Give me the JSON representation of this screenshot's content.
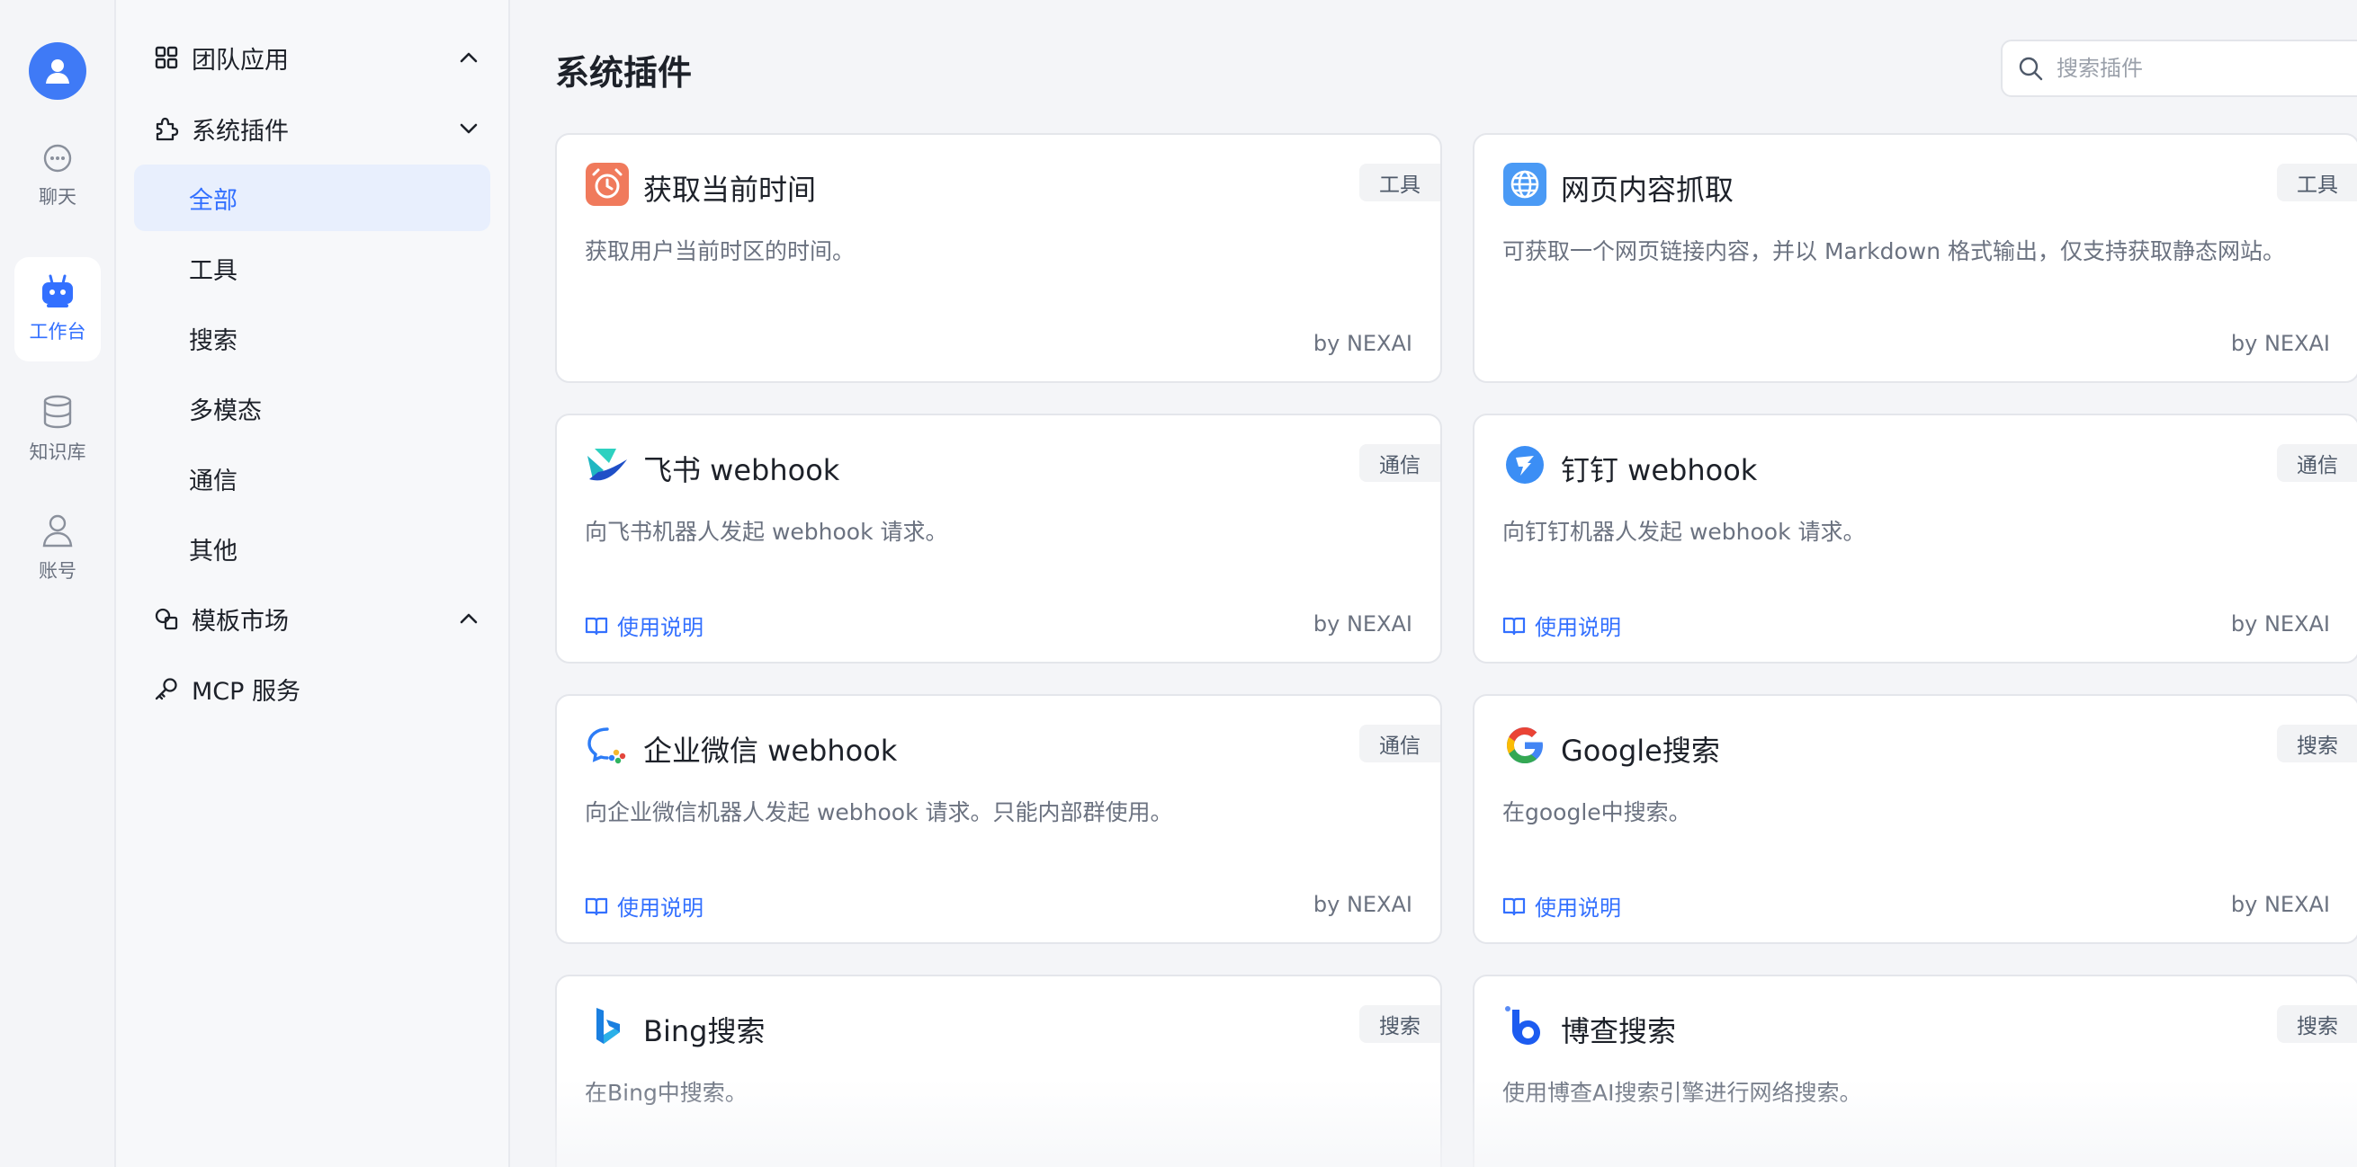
{
  "rail": {
    "items": [
      {
        "label": "聊天",
        "icon": "chat-icon"
      },
      {
        "label": "工作台",
        "icon": "bot-icon",
        "active": true
      },
      {
        "label": "知识库",
        "icon": "database-icon"
      },
      {
        "label": "账号",
        "icon": "user-icon"
      }
    ]
  },
  "menu": {
    "team_apps": "团队应用",
    "system_plugins": "系统插件",
    "subitems": [
      "全部",
      "工具",
      "搜索",
      "多模态",
      "通信",
      "其他"
    ],
    "template_market": "模板市场",
    "mcp": "MCP 服务"
  },
  "main": {
    "title": "系统插件",
    "search_placeholder": "搜索插件"
  },
  "cards": [
    {
      "title": "获取当前时间",
      "tag": "工具",
      "desc": "获取用户当前时区的时间。",
      "by": "by NEXAI",
      "icon": "alarm-clock-icon"
    },
    {
      "title": "网页内容抓取",
      "tag": "工具",
      "desc": "可获取一个网页链接内容，并以 Markdown 格式输出，仅支持获取静态网站。",
      "by": "by NEXAI",
      "icon": "globe-icon"
    },
    {
      "title": "飞书 webhook",
      "tag": "通信",
      "desc": "向飞书机器人发起 webhook 请求。",
      "doc": "使用说明",
      "by": "by NEXAI",
      "icon": "feishu-icon"
    },
    {
      "title": "钉钉 webhook",
      "tag": "通信",
      "desc": "向钉钉机器人发起 webhook 请求。",
      "doc": "使用说明",
      "by": "by NEXAI",
      "icon": "dingtalk-icon"
    },
    {
      "title": "企业微信 webhook",
      "tag": "通信",
      "desc": "向企业微信机器人发起 webhook 请求。只能内部群使用。",
      "doc": "使用说明",
      "by": "by NEXAI",
      "icon": "wecom-icon"
    },
    {
      "title": "Google搜索",
      "tag": "搜索",
      "desc": "在google中搜索。",
      "doc": "使用说明",
      "by": "by NEXAI",
      "icon": "google-icon"
    },
    {
      "title": "Bing搜索",
      "tag": "搜索",
      "desc": "在Bing中搜索。",
      "icon": "bing-icon"
    },
    {
      "title": "博查搜索",
      "tag": "搜索",
      "desc": "使用博查AI搜索引擎进行网络搜索。",
      "icon": "bocha-icon"
    }
  ],
  "colors": {
    "accent": "#3370ff",
    "avatar": "#3f7af6"
  }
}
